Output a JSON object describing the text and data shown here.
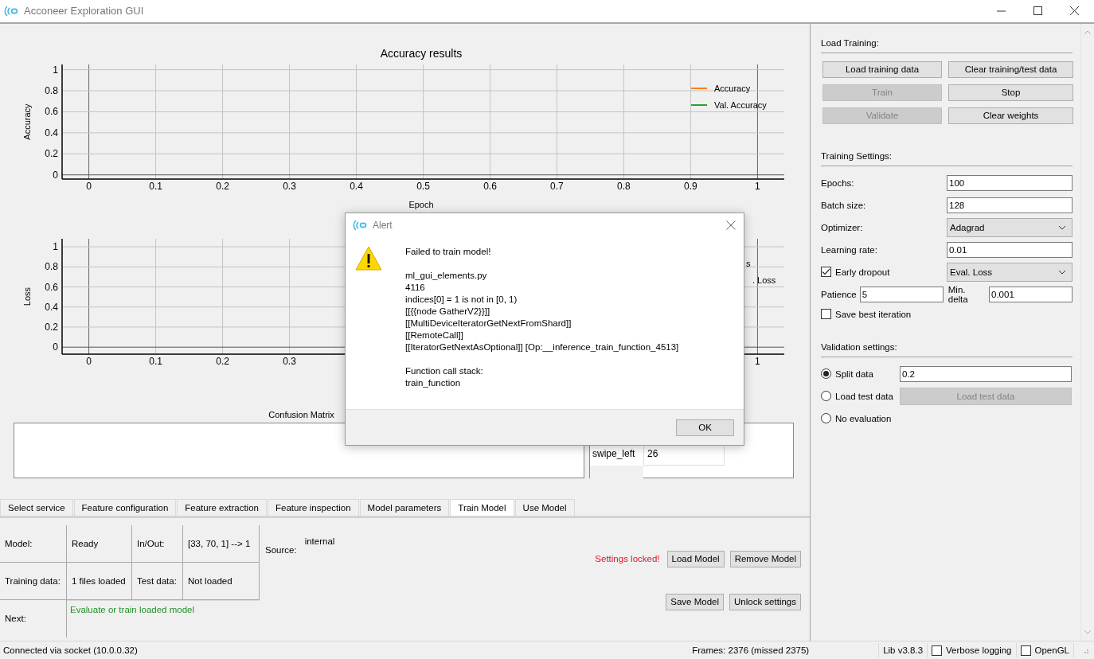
{
  "window": {
    "title": "Acconeer Exploration GUI"
  },
  "plots": [
    {
      "title": "Accuracy results",
      "xlabel": "Epoch",
      "ylabel": "Accuracy",
      "x_ticks": [
        "0",
        "0.1",
        "0.2",
        "0.3",
        "0.4",
        "0.5",
        "0.6",
        "0.7",
        "0.8",
        "0.9",
        "1"
      ],
      "y_ticks": [
        "1",
        "0.8",
        "0.6",
        "0.4",
        "0.2",
        "0"
      ],
      "legend": [
        {
          "label": "Accuracy",
          "color": "#ff7f0e"
        },
        {
          "label": "Val. Accuracy",
          "color": "#2ca02c"
        }
      ]
    },
    {
      "ylabel": "Loss",
      "x_ticks": [
        "0",
        "0.1",
        "0.2",
        "0.3",
        "1"
      ],
      "y_ticks": [
        "1",
        "0.8",
        "0.6",
        "0.4",
        "0.2",
        "0"
      ],
      "legend": [
        {
          "label": "s"
        },
        {
          "label": ". Loss"
        }
      ]
    }
  ],
  "confusion_matrix": {
    "title": "Confusion Matrix",
    "rows": [
      {
        "label": "swipe_left",
        "value": "26"
      }
    ]
  },
  "tabs": [
    {
      "label": "Select service",
      "selected": false
    },
    {
      "label": "Feature configuration",
      "selected": false
    },
    {
      "label": "Feature extraction",
      "selected": false
    },
    {
      "label": "Feature inspection",
      "selected": false
    },
    {
      "label": "Model parameters",
      "selected": false
    },
    {
      "label": "Train Model",
      "selected": true
    },
    {
      "label": "Use Model",
      "selected": false
    }
  ],
  "model_info": {
    "rows": [
      {
        "cells": [
          {
            "kind": "label",
            "text": "Model:"
          },
          {
            "kind": "value",
            "text": "Ready"
          },
          {
            "kind": "label",
            "text": "In/Out:"
          },
          {
            "kind": "value",
            "text": "[33, 70, 1] --> 1"
          }
        ]
      },
      {
        "cells": [
          {
            "kind": "label",
            "text": "Training data:"
          },
          {
            "kind": "value",
            "text": "1 files loaded"
          },
          {
            "kind": "label",
            "text": "Test data:"
          },
          {
            "kind": "value",
            "text": "Not loaded"
          }
        ]
      },
      {
        "cells": [
          {
            "kind": "label",
            "text": "Next:"
          },
          {
            "kind": "status",
            "text": "Evaluate or train loaded model"
          }
        ]
      }
    ],
    "source": {
      "label": "Source:",
      "value": "internal"
    }
  },
  "model_actions": {
    "notice": "Settings locked!",
    "rows": [
      {
        "buttons": [
          "Load Model",
          "Remove Model"
        ]
      },
      {
        "buttons": [
          "Save Model",
          "Unlock settings"
        ]
      }
    ]
  },
  "load_training": {
    "title": "Load Training:",
    "buttons": [
      {
        "label": "Load training data",
        "disabled": false
      },
      {
        "label": "Clear training/test data",
        "disabled": false
      },
      {
        "label": "Train",
        "disabled": true
      },
      {
        "label": "Stop",
        "disabled": false
      },
      {
        "label": "Validate",
        "disabled": true
      },
      {
        "label": "Clear weights",
        "disabled": false
      }
    ]
  },
  "training_settings": {
    "title": "Training Settings:",
    "fields": [
      {
        "kind": "input",
        "label": "Epochs:",
        "value": "100"
      },
      {
        "kind": "input",
        "label": "Batch size:",
        "value": "128"
      },
      {
        "kind": "select",
        "label": "Optimizer:",
        "value": "Adagrad"
      },
      {
        "kind": "input",
        "label": "Learning rate:",
        "value": "0.01"
      },
      {
        "kind": "check-select",
        "label": "Early dropout",
        "checked": true,
        "value": "Eval. Loss"
      },
      {
        "kind": "pair",
        "label": "Patience",
        "value": "5",
        "label2": "Min. delta",
        "value2": "0.001"
      },
      {
        "kind": "check",
        "label": "Save best iteration",
        "checked": false
      }
    ]
  },
  "validation_settings": {
    "title": "Validation settings:",
    "options": [
      {
        "kind": "input",
        "label": "Split data",
        "selected": true,
        "value": "0.2"
      },
      {
        "kind": "button",
        "label": "Load test data",
        "selected": false,
        "button": {
          "label": "Load test data",
          "disabled": true
        }
      },
      {
        "kind": "plain",
        "label": "No evaluation",
        "selected": false
      }
    ]
  },
  "status_bar": {
    "connection": "Connected via socket (10.0.0.32)",
    "frames": "Frames: 2376 (missed 2375)",
    "lib": "Lib v3.8.3",
    "checks": [
      {
        "label": "Verbose logging",
        "checked": false
      },
      {
        "label": "OpenGL",
        "checked": false
      }
    ]
  },
  "alert": {
    "title": "Alert",
    "message": "Failed to train model!\n\nml_gui_elements.py\n4116\nindices[0] = 1 is not in [0, 1)\n[[{{node GatherV2}}]]\n[[MultiDeviceIteratorGetNextFromShard]]\n[[RemoteCall]]\n[[IteratorGetNextAsOptional]] [Op:__inference_train_function_4513]\n\nFunction call stack:\ntrain_function",
    "button": "OK"
  }
}
